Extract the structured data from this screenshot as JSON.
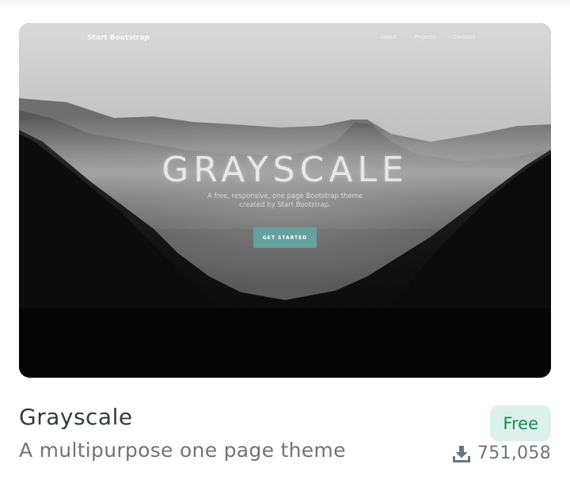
{
  "theme": {
    "title": "Grayscale",
    "description": "A multipurpose one page theme",
    "price": "Free",
    "downloads": "751,058",
    "download_icon": "download-icon",
    "colors": {
      "price_text": "#19875a",
      "price_bg": "#dcf1eb",
      "title": "#343a40",
      "muted": "#6c757d"
    }
  },
  "preview": {
    "brand": "Start Bootstrap",
    "nav": [
      "About",
      "Projects",
      "Contact"
    ],
    "title": "GRAYSCALE",
    "subtitle_line1": "A free, responsive, one page Bootstrap theme",
    "subtitle_line2": "created by Start Bootstrap.",
    "button": "GET STARTED",
    "colors": {
      "button": "#64a19d"
    }
  }
}
